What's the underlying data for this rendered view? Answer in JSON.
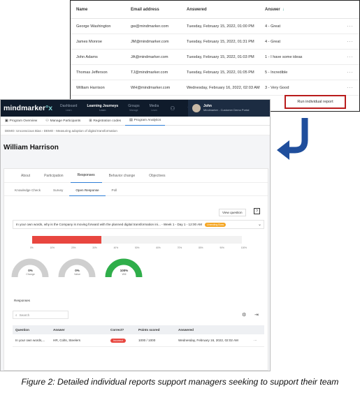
{
  "top_table": {
    "headers": [
      "Name",
      "Email address",
      "Answered",
      "Answer"
    ],
    "rows": [
      {
        "name": "George Washington",
        "email": "gw@mindmarker.com",
        "answered": "Tuesday, February 15, 2022, 01:00 PM",
        "answer": "4 - Great"
      },
      {
        "name": "James Monroe",
        "email": "JM@mindmarker.com",
        "answered": "Tuesday, February 15, 2022, 01:31 PM",
        "answer": "4 - Great"
      },
      {
        "name": "John Adams",
        "email": "JA@mindmarker.com",
        "answered": "Tuesday, February 15, 2022, 01:03 PM",
        "answer": "1 - I have some ideas"
      },
      {
        "name": "Thomas Jefferson",
        "email": "TJ@mindmarker.com",
        "answered": "Tuesday, February 15, 2022, 01:05 PM",
        "answer": "5 - Incredible"
      },
      {
        "name": "William Harrison",
        "email": "WH@mindmarker.com",
        "answered": "Wednesday, February 16, 2022, 02:03 AM",
        "answer": "3 - Very Good"
      }
    ],
    "more_glyph": "···",
    "run_report_label": "Run individual report"
  },
  "nav": {
    "logo_main": "mindmarker",
    "logo_x": "°x",
    "items": [
      {
        "label": "Dashboard",
        "sub": "Learn"
      },
      {
        "label": "Learning Journeys",
        "sub": "Learn"
      },
      {
        "label": "Groups",
        "sub": "Manage"
      },
      {
        "label": "Media",
        "sub": "Learn"
      }
    ],
    "user_name": "John",
    "user_sub": "Mindmarker - Customer Demo Portal"
  },
  "subnav": [
    "Program Overview",
    "Manage Participants",
    "Registration codes",
    "Program Analytics"
  ],
  "breadcrumb": "DEMO: Unconscious Bias  ›  DEMO - Measuring adoption of digital transformation",
  "page_title": "William Harrison",
  "tabs1": [
    "About",
    "Participation",
    "Responses",
    "Behavior change",
    "Objectives"
  ],
  "tabs2": [
    "Knowledge Check",
    "Survey",
    "Open Response",
    "Poll"
  ],
  "view_question": "View question",
  "question": {
    "text": "In your own words, why is the Company is moving forward with the planned digital transformation ini... - Week 1 - Day 1 - 12:00 AM",
    "badge": "Unending Boss"
  },
  "bar": {
    "fill_percent": 33,
    "ticks": [
      "0%",
      "10%",
      "20%",
      "30%",
      "40%",
      "50%",
      "60%",
      "70%",
      "80%",
      "90%",
      "100%"
    ]
  },
  "gauges": [
    {
      "value": "0%",
      "label": "Change",
      "fraction": 0
    },
    {
      "value": "0%",
      "label": "Value",
      "fraction": 0
    },
    {
      "value": "100%",
      "label": "Will",
      "fraction": 1
    }
  ],
  "responses_label": "Responses",
  "search_placeholder": "Search",
  "responses_table": {
    "headers": [
      "Question",
      "Answer",
      "Correct?",
      "Points scored",
      "Answered",
      ""
    ],
    "row": {
      "question": "In your own words,...",
      "answer": "HR, Colts, Steelers",
      "correct": "Incorrect",
      "points": "1000 / 1000",
      "answered": "Wednesday, February 16, 2022, 02:02 AM",
      "more": "···"
    }
  },
  "caption": "Figure 2: Detailed individual reports support managers seeking to support their team",
  "colors": {
    "nav_bg": "#0f1b2b",
    "accent_red": "#e8463f",
    "gauge_green": "#2fae4a",
    "arrow_blue": "#1f4e9c"
  }
}
